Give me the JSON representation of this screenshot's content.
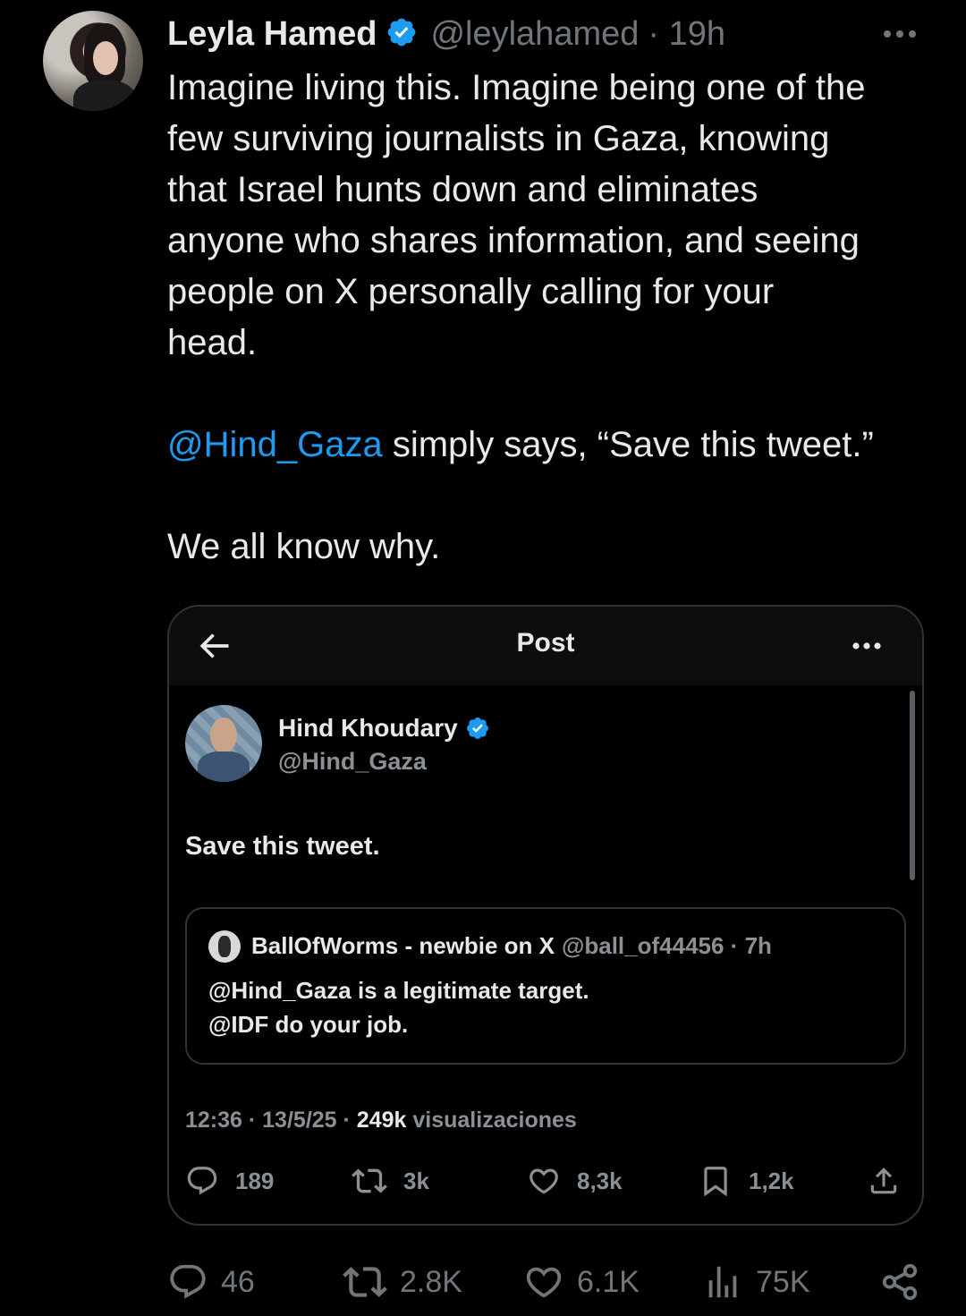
{
  "author": {
    "name": "Leyla Hamed",
    "handle": "@leylahamed",
    "time": "· 19h",
    "verified": true
  },
  "tweet": {
    "line1": "Imagine living this. Imagine being one of the",
    "line2": "few surviving journalists in Gaza, knowing",
    "line3": "that Israel hunts down and eliminates",
    "line4": "anyone who shares information, and seeing",
    "line5": "people on X personally calling for your",
    "line6": "head.",
    "mention": "@Hind_Gaza",
    "mention_rest": " simply says, “Save this tweet.”",
    "closing": "We all know why."
  },
  "card": {
    "title": "Post",
    "author_name": "Hind Khoudary",
    "author_handle": "@Hind_Gaza",
    "text": "Save this tweet.",
    "quote": {
      "name": "BallOfWorms - newbie on X",
      "handle_time": "@ball_of44456 · 7h",
      "line1": "@Hind_Gaza is a legitimate target.",
      "line2": "@IDF do your job."
    },
    "meta_prefix": "12:36 · 13/5/25 · ",
    "meta_views": "249k",
    "meta_suffix": " visualizaciones",
    "actions": {
      "replies": "189",
      "reposts": "3k",
      "likes": "8,3k",
      "bookmarks": "1,2k"
    }
  },
  "actions": {
    "replies": "46",
    "reposts": "2.8K",
    "likes": "6.1K",
    "views": "75K"
  },
  "colors": {
    "background": "#000000",
    "text": "#e7e9ea",
    "muted": "#71767b",
    "link": "#1d9bf0",
    "verified": "#1d9bf0"
  }
}
